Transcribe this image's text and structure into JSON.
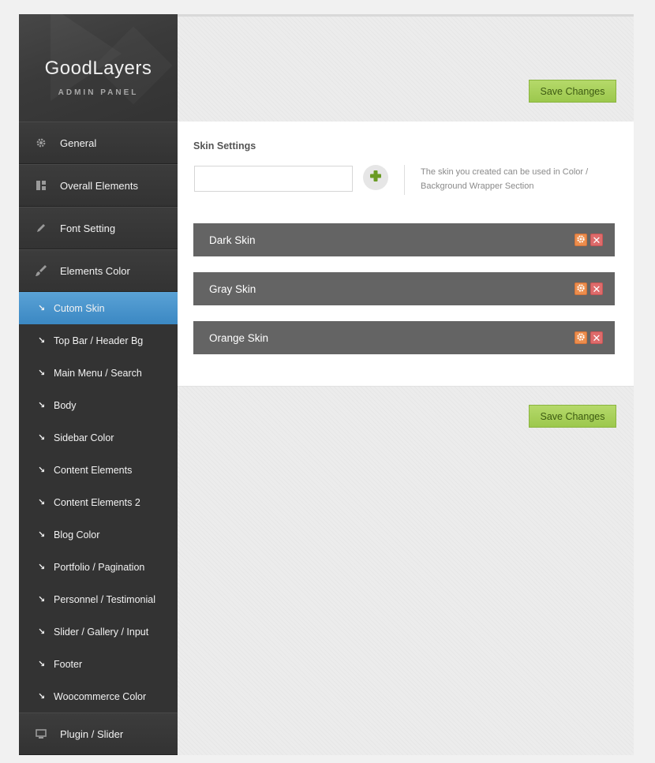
{
  "logo": {
    "title": "GoodLayers",
    "subtitle": "ADMIN PANEL"
  },
  "sidebar": {
    "main_items": [
      {
        "label": "General",
        "icon": "gear-icon"
      },
      {
        "label": "Overall Elements",
        "icon": "layout-icon"
      },
      {
        "label": "Font Setting",
        "icon": "pencil-icon"
      },
      {
        "label": "Elements Color",
        "icon": "brush-icon"
      },
      {
        "label": "Plugin / Slider",
        "icon": "monitor-icon"
      }
    ],
    "sub_items": [
      {
        "label": "Cutom Skin",
        "active": true
      },
      {
        "label": "Top Bar / Header Bg"
      },
      {
        "label": "Main Menu / Search"
      },
      {
        "label": "Body"
      },
      {
        "label": "Sidebar Color"
      },
      {
        "label": "Content Elements"
      },
      {
        "label": "Content Elements 2"
      },
      {
        "label": "Blog Color"
      },
      {
        "label": "Portfolio / Pagination"
      },
      {
        "label": "Personnel / Testimonial"
      },
      {
        "label": "Slider / Gallery / Input"
      },
      {
        "label": "Footer"
      },
      {
        "label": "Woocommerce Color"
      }
    ],
    "sub_arrow": "↘"
  },
  "toolbar": {
    "save_label": "Save Changes"
  },
  "skin_settings": {
    "heading": "Skin Settings",
    "input_value": "",
    "input_placeholder": "",
    "help_text": "The skin you created can be used in Color / Background Wrapper Section",
    "skins": [
      {
        "name": "Dark Skin"
      },
      {
        "name": "Gray Skin"
      },
      {
        "name": "Orange Skin"
      }
    ],
    "delete_glyph": "✕"
  },
  "colors": {
    "active_item": "#4a95cd",
    "save_button": "#a8cf5b",
    "skin_row": "#646464",
    "edit_button": "#ec8d4c",
    "delete_button": "#de6b6b",
    "add_icon": "#6a9b24"
  }
}
